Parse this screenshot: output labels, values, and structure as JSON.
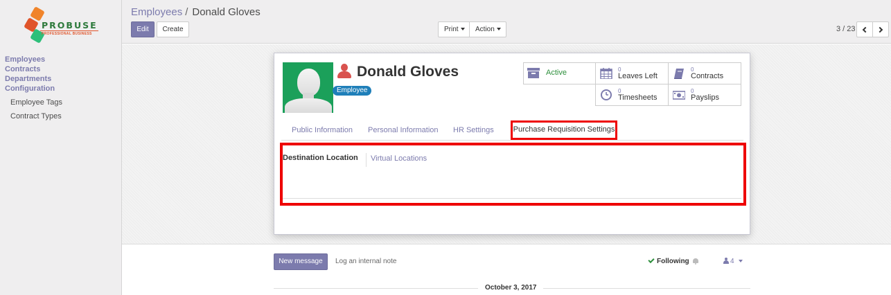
{
  "sidebar": {
    "logo": {
      "brand": "PROBUSE",
      "tagline": "PROFESSIONAL BUSINESS"
    },
    "menu": [
      {
        "label": "Employees"
      },
      {
        "label": "Contracts"
      },
      {
        "label": "Departments"
      },
      {
        "label": "Configuration"
      }
    ],
    "submenu": [
      {
        "label": "Employee Tags"
      },
      {
        "label": "Contract Types"
      }
    ]
  },
  "header": {
    "breadcrumb_parent": "Employees",
    "breadcrumb_separator": "/",
    "breadcrumb_current": "Donald Gloves",
    "edit_label": "Edit",
    "create_label": "Create",
    "print_label": "Print",
    "action_label": "Action",
    "pager": "3 / 23"
  },
  "employee": {
    "name": "Donald Gloves",
    "tag": "Employee",
    "avatar_color": "#1ba05a"
  },
  "smart_buttons": {
    "active": {
      "label": "Active",
      "icon": "archive-icon"
    },
    "leaves": {
      "count": "0",
      "label": "Leaves Left",
      "icon": "calendar-icon"
    },
    "contracts": {
      "count": "0",
      "label": "Contracts",
      "icon": "book-icon"
    },
    "timesheets": {
      "count": "0",
      "label": "Timesheets",
      "icon": "clock-icon"
    },
    "payslips": {
      "count": "0",
      "label": "Payslips",
      "icon": "money-icon"
    }
  },
  "tabs": [
    {
      "label": "Public Information"
    },
    {
      "label": "Personal Information"
    },
    {
      "label": "HR Settings"
    },
    {
      "label": "Purchase Requisition Settings",
      "active": true
    }
  ],
  "form": {
    "destination_label": "Destination Location",
    "destination_value": "Virtual Locations"
  },
  "chatter": {
    "new_message": "New message",
    "log_note": "Log an internal note",
    "following": "Following",
    "followers_count": "4",
    "date": "October 3, 2017"
  },
  "colors": {
    "accent": "#7c7bad",
    "highlight": "#ee0000",
    "active_green": "#2d8f3c",
    "tag_blue": "#1f7fb9"
  }
}
